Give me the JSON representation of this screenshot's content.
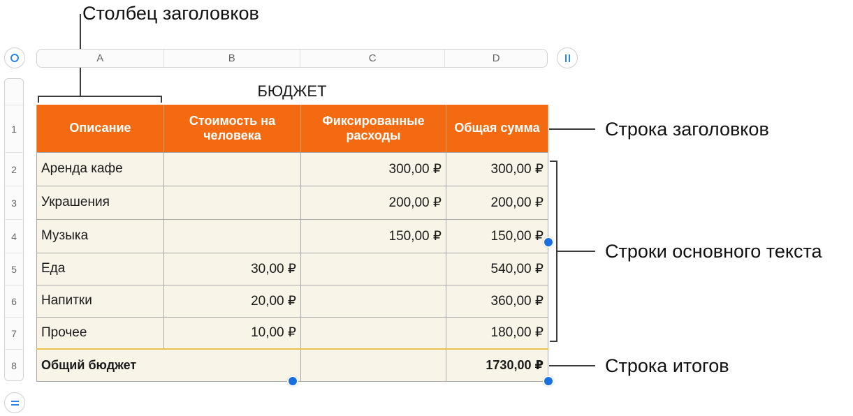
{
  "callouts": {
    "header_column": "Столбец заголовков",
    "header_row": "Строка заголовков",
    "body_rows": "Строки основного текста",
    "footer_row": "Строка итогов"
  },
  "column_letters": [
    "A",
    "B",
    "C",
    "D"
  ],
  "row_numbers": [
    "1",
    "2",
    "3",
    "4",
    "5",
    "6",
    "7",
    "8"
  ],
  "table": {
    "title": "БЮДЖЕТ",
    "headers": [
      "Описание",
      "Стоимость на человека",
      "Фиксированные расходы",
      "Общая сумма"
    ],
    "rows": [
      [
        "Аренда кафе",
        "",
        "300,00 ₽",
        "300,00 ₽"
      ],
      [
        "Украшения",
        "",
        "200,00 ₽",
        "200,00 ₽"
      ],
      [
        "Музыка",
        "",
        "150,00 ₽",
        "150,00 ₽"
      ],
      [
        "Еда",
        "30,00 ₽",
        "",
        "540,00 ₽"
      ],
      [
        "Напитки",
        "20,00 ₽",
        "",
        "360,00 ₽"
      ],
      [
        "Прочее",
        "10,00 ₽",
        "",
        "180,00 ₽"
      ]
    ],
    "footer": [
      "Общий бюджет",
      "1730,00 ₽"
    ]
  },
  "accent_color": "#f36a10",
  "handle_color": "#1a6fe0"
}
